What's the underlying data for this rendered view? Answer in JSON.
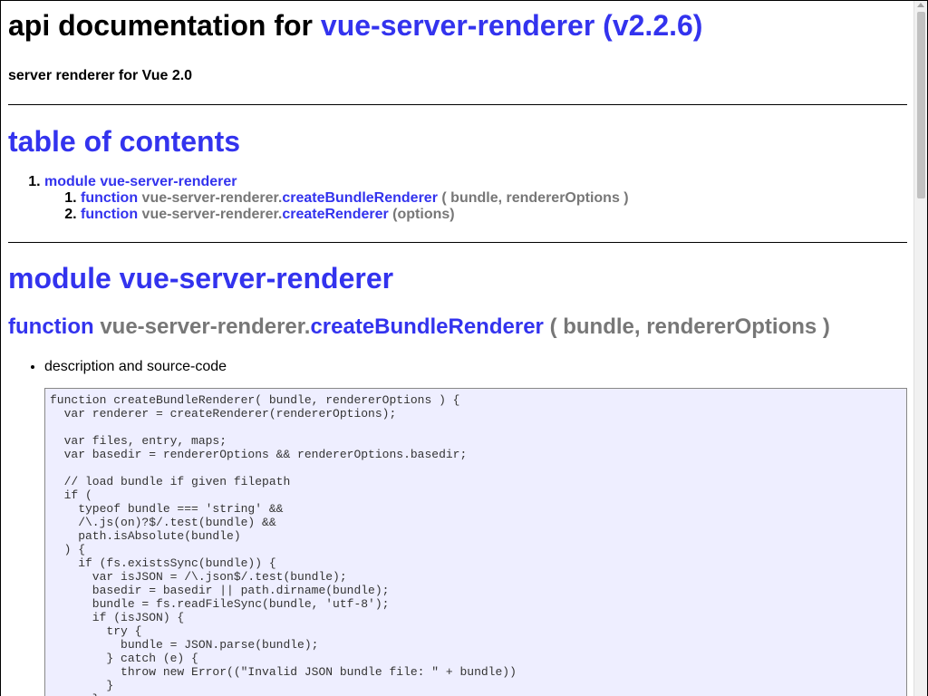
{
  "header": {
    "title_prefix": "api documentation for",
    "title_link": "vue-server-renderer (v2.2.6)",
    "subtitle": "server renderer for Vue 2.0"
  },
  "toc": {
    "title": "table of contents",
    "module_label": "module vue-server-renderer",
    "items": [
      {
        "keyword": "function",
        "prefix": "vue-server-renderer.",
        "name": "createBundleRenderer",
        "args": "( bundle, rendererOptions )"
      },
      {
        "keyword": "function",
        "prefix": "vue-server-renderer.",
        "name": "createRenderer",
        "args": "(options)"
      }
    ]
  },
  "module": {
    "title": "module vue-server-renderer"
  },
  "function_section": {
    "keyword": "function",
    "prefix": "vue-server-renderer.",
    "name": "createBundleRenderer",
    "args": "( bundle, rendererOptions )",
    "description_label": "description and source-code",
    "code": "function createBundleRenderer( bundle, rendererOptions ) {\n  var renderer = createRenderer(rendererOptions);\n\n  var files, entry, maps;\n  var basedir = rendererOptions && rendererOptions.basedir;\n\n  // load bundle if given filepath\n  if (\n    typeof bundle === 'string' &&\n    /\\.js(on)?$/.test(bundle) &&\n    path.isAbsolute(bundle)\n  ) {\n    if (fs.existsSync(bundle)) {\n      var isJSON = /\\.json$/.test(bundle);\n      basedir = basedir || path.dirname(bundle);\n      bundle = fs.readFileSync(bundle, 'utf-8');\n      if (isJSON) {\n        try {\n          bundle = JSON.parse(bundle);\n        } catch (e) {\n          throw new Error((\"Invalid JSON bundle file: \" + bundle))\n        }\n      }"
  },
  "colors": {
    "link": "#3333ee",
    "muted": "#777777",
    "code_bg": "#eeeeff"
  }
}
